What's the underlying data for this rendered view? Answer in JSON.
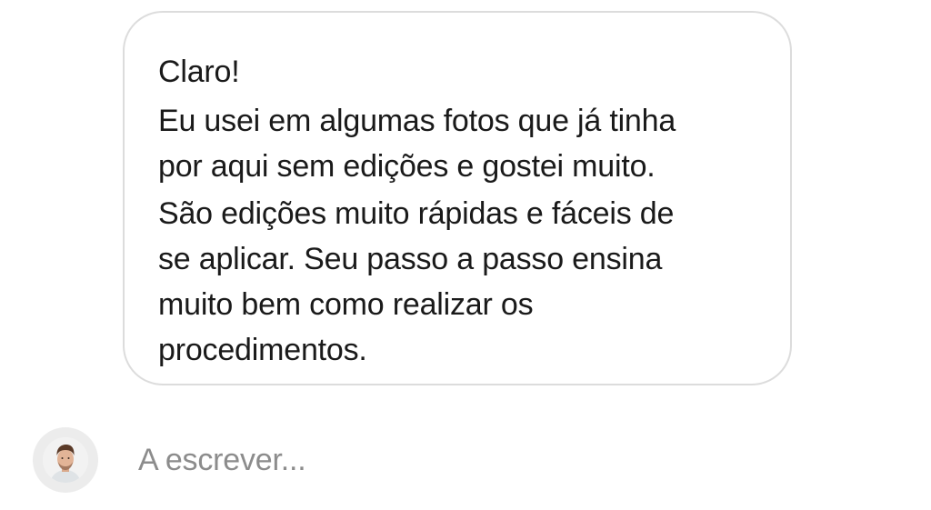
{
  "message": {
    "lines": [
      "Claro!",
      "Eu usei em algumas fotos que já tinha",
      "por aqui sem edições e gostei muito.",
      "São edições muito rápidas e fáceis de",
      "se aplicar. Seu passo a passo ensina",
      "muito bem como realizar os",
      "procedimentos."
    ]
  },
  "typing_indicator": {
    "avatar_icon": "user-avatar-photo",
    "text": "A escrever..."
  },
  "colors": {
    "bubble_border": "#dcdcdc",
    "message_text": "#1a1a1a",
    "typing_text": "#8c8c8c",
    "avatar_ring": "#ececec"
  }
}
